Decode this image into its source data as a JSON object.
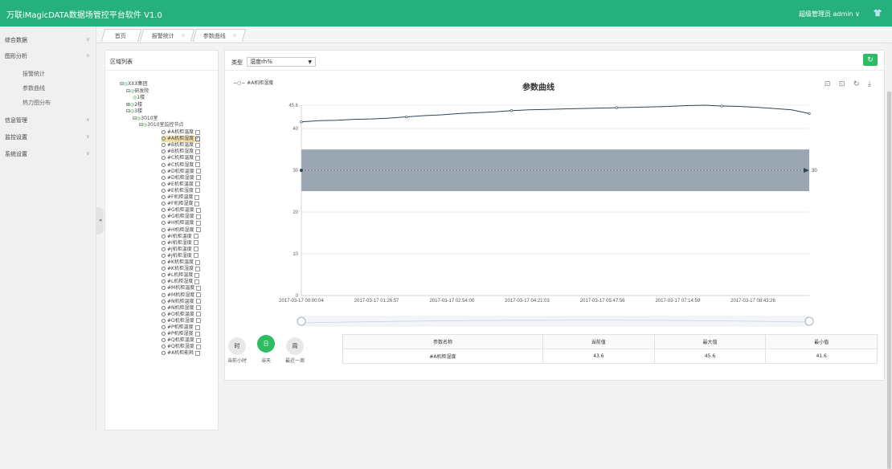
{
  "header": {
    "app_title": "万联iMagicDATA数据场管控平台软件 V1.0",
    "user": "超级管理员 admin ∨",
    "shirt_icon": "shirt-icon"
  },
  "sidebar": {
    "items": [
      {
        "label": "综合数据",
        "chev": "∨"
      },
      {
        "label": "图形分析",
        "chev": "∧",
        "sub": [
          "报警统计",
          "参数曲线",
          "热力图分布"
        ]
      },
      {
        "label": "信息管理",
        "chev": "∨"
      },
      {
        "label": "监控设置",
        "chev": "∨"
      },
      {
        "label": "系统设置",
        "chev": "∨"
      }
    ],
    "collapse_glyph": "◂"
  },
  "tabs": [
    {
      "label": "首页"
    },
    {
      "label": "报警统计",
      "close": "×"
    },
    {
      "label": "参数曲线",
      "close": "×"
    }
  ],
  "tree": {
    "title": "区域列表",
    "nodes": [
      {
        "prefix": "⊟",
        "label": "XXX集团"
      },
      {
        "prefix": "⊟",
        "label": "研发院"
      },
      {
        "prefix": "",
        "label": "1楼"
      },
      {
        "prefix": "⊞",
        "label": "2楼"
      },
      {
        "prefix": "⊟",
        "label": "3楼"
      },
      {
        "prefix": "⊟",
        "label": "3010室"
      },
      {
        "prefix": "⊟",
        "label": "3010室监控节点"
      }
    ],
    "leaves": [
      "#A机柜温度",
      "#A机柜湿度",
      "#B机柜温度",
      "#B机柜湿度",
      "#C机柜温度",
      "#C机柜湿度",
      "#D机柜温度",
      "#D机柜湿度",
      "#E机柜温度",
      "#E机柜湿度",
      "#F机柜温度",
      "#F机柜湿度",
      "#G机柜温度",
      "#G机柜湿度",
      "#H机柜温度",
      "#H机柜湿度",
      "#I机柜温度",
      "#I机柜湿度",
      "#J机柜温度",
      "#J机柜湿度",
      "#K机柜温度",
      "#K机柜湿度",
      "#L机柜温度",
      "#L机柜湿度",
      "#M机柜温度",
      "#M机柜湿度",
      "#N机柜温度",
      "#N机柜湿度",
      "#O机柜温度",
      "#O机柜湿度",
      "#P机柜温度",
      "#P机柜湿度",
      "#Q机柜温度",
      "#Q机柜湿度",
      "#A机柜能耗"
    ],
    "checked_index": 1
  },
  "main": {
    "type_label": "类型",
    "type_value": "湿度rh%",
    "type_arrow": "▼",
    "refresh_glyph": "↻",
    "legend": "#A机柜湿度",
    "toolbox": "⊡ ⊡ ↻ ⤓"
  },
  "chart_data": {
    "type": "line",
    "title": "参数曲线",
    "series": [
      {
        "name": "#A机柜湿度",
        "values": [
          41.6,
          41.9,
          42.0,
          42.2,
          42.3,
          42.5,
          42.8,
          43.1,
          43.3,
          43.6,
          43.8,
          44.0,
          44.3,
          44.5,
          44.6,
          44.7,
          44.8,
          44.9,
          45.0,
          45.1,
          45.2,
          45.3,
          45.5,
          45.6,
          45.4,
          45.3,
          45.1,
          44.8,
          44.5,
          43.6
        ]
      }
    ],
    "ylim": [
      0,
      45.6
    ],
    "yticks": [
      0,
      10,
      20,
      30,
      40,
      45.6
    ],
    "x_labels": [
      "2017-03-17 00:00:04",
      "2017-03-17 01:26:57",
      "2017-03-17 02:54:00",
      "2017-03-17 04:21:03",
      "2017-03-17 05:47:56",
      "2017-03-17 07:14:59",
      "2017-03-17 08:43:26"
    ],
    "band": [
      25,
      35
    ],
    "markline": 30,
    "markline_label": "30",
    "colors": {
      "line": "#2f4554",
      "band": "#9aa7b3",
      "grid": "#dddddd"
    }
  },
  "range_buttons": [
    {
      "glyph": "时",
      "label": "当前小时",
      "active": false
    },
    {
      "glyph": "日",
      "label": "当天",
      "active": true
    },
    {
      "glyph": "周",
      "label": "最近一周",
      "active": false
    }
  ],
  "param_table": {
    "headers": [
      "参数名称",
      "当前值",
      "最大值",
      "最小值"
    ],
    "rows": [
      [
        "#A机柜湿度",
        "43.6",
        "45.6",
        "41.6"
      ]
    ]
  }
}
